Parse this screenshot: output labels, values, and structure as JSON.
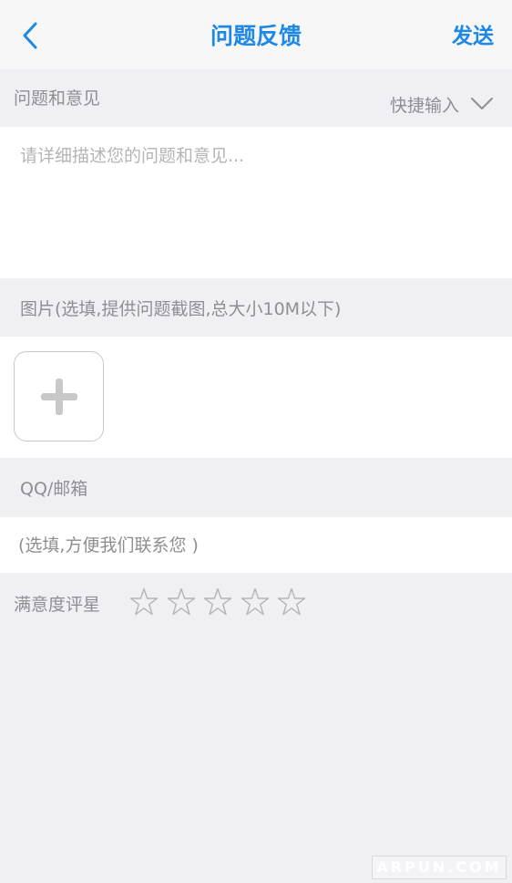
{
  "nav": {
    "title": "问题反馈",
    "send_label": "发送",
    "accent_color": "#1E88E5",
    "back_icon": "chevron-left-icon"
  },
  "feedback": {
    "section_label": "问题和意见",
    "quick_input_label": "快捷输入",
    "quick_input_icon": "chevron-down-icon",
    "placeholder": "请详细描述您的问题和意见..."
  },
  "images": {
    "section_label": "图片(选填,提供问题截图,总大小10M以下)",
    "add_icon": "plus-icon"
  },
  "contact": {
    "section_label": "QQ/邮箱",
    "placeholder": "(选填,方便我们联系您 )"
  },
  "rating": {
    "label": "满意度评星",
    "max_stars": 5,
    "value": 0,
    "star_icon": "star-outline-icon"
  },
  "watermark": {
    "text": "ARPUN.COM"
  }
}
